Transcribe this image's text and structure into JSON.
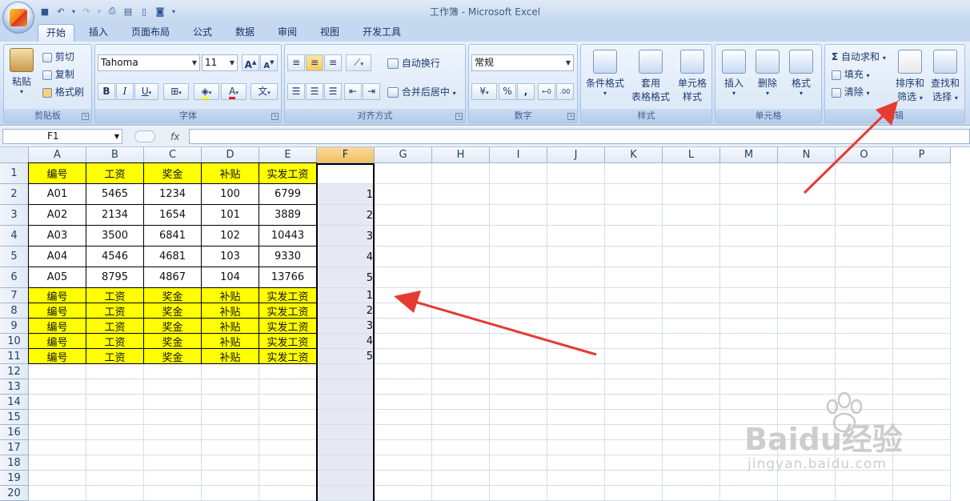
{
  "app": {
    "title": "工作簿 - Microsoft Excel"
  },
  "tabs": [
    "开始",
    "插入",
    "页面布局",
    "公式",
    "数据",
    "审阅",
    "视图",
    "开发工具"
  ],
  "ribbon": {
    "clipboard": {
      "label": "剪贴板",
      "paste": "粘贴",
      "cut": "剪切",
      "copy": "复制",
      "format_painter": "格式刷"
    },
    "font": {
      "label": "字体",
      "name": "Tahoma",
      "size": "11",
      "bold": "B",
      "italic": "I",
      "underline": "U",
      "grow": "A",
      "shrink": "A",
      "color_letter": "A",
      "wen": "文"
    },
    "alignment": {
      "label": "对齐方式",
      "wrap": "自动换行",
      "merge": "合并后居中"
    },
    "number": {
      "label": "数字",
      "format": "常规",
      "percent": "%",
      "comma": ",",
      "inc": "+.0 .00",
      "dec": ".00 →.0"
    },
    "styles": {
      "label": "样式",
      "conditional": "条件格式",
      "table_format_1": "套用",
      "table_format_2": "表格格式",
      "cell_styles_1": "单元格",
      "cell_styles_2": "样式"
    },
    "cells": {
      "label": "单元格",
      "insert": "插入",
      "delete": "删除",
      "format": "格式"
    },
    "editing": {
      "label": "编辑",
      "autosum": "自动求和",
      "fill": "填充",
      "clear": "清除",
      "sort_1": "排序和",
      "sort_2": "筛选",
      "find_1": "查找和",
      "find_2": "选择",
      "sigma": "Σ"
    }
  },
  "formula_bar": {
    "name_box": "F1",
    "fx": "fx",
    "formula": ""
  },
  "columns": [
    "A",
    "B",
    "C",
    "D",
    "E",
    "F",
    "G",
    "H",
    "I",
    "J",
    "K",
    "L",
    "M",
    "N",
    "O",
    "P"
  ],
  "rows": [
    "1",
    "2",
    "3",
    "4",
    "5",
    "6",
    "7",
    "8",
    "9",
    "10",
    "11",
    "12",
    "13",
    "14",
    "15",
    "16",
    "17",
    "18",
    "19",
    "20"
  ],
  "table": {
    "header": [
      "编号",
      "工资",
      "奖金",
      "补贴",
      "实发工资"
    ],
    "data": [
      [
        "A01",
        "5465",
        "1234",
        "100",
        "6799",
        "1"
      ],
      [
        "A02",
        "2134",
        "1654",
        "101",
        "3889",
        "2"
      ],
      [
        "A03",
        "3500",
        "6841",
        "102",
        "10443",
        "3"
      ],
      [
        "A04",
        "4546",
        "4681",
        "103",
        "9330",
        "4"
      ],
      [
        "A05",
        "8795",
        "4867",
        "104",
        "13766",
        "5"
      ]
    ],
    "repeat_rows": [
      [
        "编号",
        "工资",
        "奖金",
        "补贴",
        "实发工资",
        "1"
      ],
      [
        "编号",
        "工资",
        "奖金",
        "补贴",
        "实发工资",
        "2"
      ],
      [
        "编号",
        "工资",
        "奖金",
        "补贴",
        "实发工资",
        "3"
      ],
      [
        "编号",
        "工资",
        "奖金",
        "补贴",
        "实发工资",
        "4"
      ],
      [
        "编号",
        "工资",
        "奖金",
        "补贴",
        "实发工资",
        "5"
      ]
    ]
  },
  "colors": {
    "highlight": "#ffff00",
    "selected_col": "#e6e9f4",
    "arrow": "#e53b32"
  },
  "watermark": {
    "line1": "Baidu经验",
    "line2": "jingyan.baidu.com"
  }
}
